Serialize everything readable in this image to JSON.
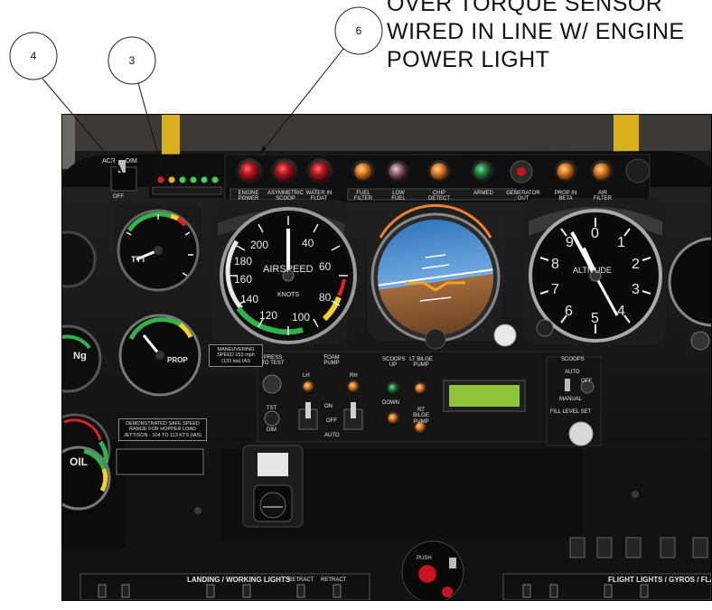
{
  "callouts": [
    {
      "number": "4"
    },
    {
      "number": "3"
    },
    {
      "number": "6"
    }
  ],
  "annotation": {
    "lines": [
      "OVER TORQUE SENSOR",
      "WIRED IN LINE W/ ENGINE",
      "POWER LIGHT"
    ]
  },
  "panel": {
    "switch_labels": {
      "acr": "ACR",
      "dim": "DIM",
      "off": "OFF"
    },
    "annunciator_labels": [
      "ENGINE POWER",
      "ASYMMETRIC SCOOP",
      "WATER IN FLOAT",
      "FUEL FILTER",
      "LOW FUEL",
      "CHIP DETECT",
      "ARMED",
      "GENERATOR OUT",
      "PROP IN BETA",
      "AIR FILTER"
    ],
    "airspeed": {
      "title": "AIRSPEED",
      "units": "KNOTS",
      "scale": [
        "40",
        "60",
        "80",
        "100",
        "120",
        "140",
        "160",
        "180",
        "200"
      ]
    },
    "altimeter": {
      "title": "ALTITUDE",
      "scale": [
        "0",
        "1",
        "2",
        "3",
        "4",
        "5",
        "6",
        "7",
        "8",
        "9"
      ]
    },
    "torque_gauge": {
      "title": "TTT"
    },
    "np_gauge": {
      "title": "PROP"
    },
    "oil_gauge": {
      "title": "OIL"
    },
    "ng_gauge": {
      "title": "Ng"
    },
    "controls": {
      "press_to_test": "PRESS TO TEST",
      "foam_pump": "FOAM PUMP",
      "lh": "LH",
      "rh": "RH",
      "on": "ON",
      "off": "OFF",
      "auto": "AUTO",
      "scoops_up": "SCOOPS UP",
      "down": "DOWN",
      "lt_bilge_pump": "LT BILGE PUMP",
      "rt_bilge_pump": "RT BILGE PUMP",
      "tst": "TST",
      "dim": "DIM",
      "scoops": "SCOOPS",
      "scoops_auto": "AUTO",
      "scoops_off": "OFF",
      "manual": "MANUAL",
      "fill_level_set": "FILL LEVEL SET",
      "push": "PUSH"
    },
    "placards": {
      "maneuvering": "MANEUVERING SPEED 153 mph (133 kts) IAS",
      "hopper": "DEMONSTRATED SAFE SPEED RANGE FOR HOPPER LOAD JETTISON - 104 TO 113 KTS (IAS)"
    },
    "bottom_bars": {
      "landing": "LANDING / WORKING LIGHTS",
      "flight": "FLIGHT LIGHTS / GYROS / FLAPS",
      "retract": "RETRACT"
    }
  },
  "colors": {
    "panel_black": "#161616",
    "annunciator_red": "#b3141e",
    "annunciator_amber": "#e07a20",
    "annunciator_green": "#1f7a3d",
    "arc_green": "#2fb34a",
    "arc_yellow": "#f2d22a",
    "arc_red": "#e02222",
    "attitude_sky": "#4a8fd0",
    "attitude_ground": "#8a5a34",
    "lcd_green": "#8fc43a",
    "yellow_frame": "#d8b21c"
  }
}
